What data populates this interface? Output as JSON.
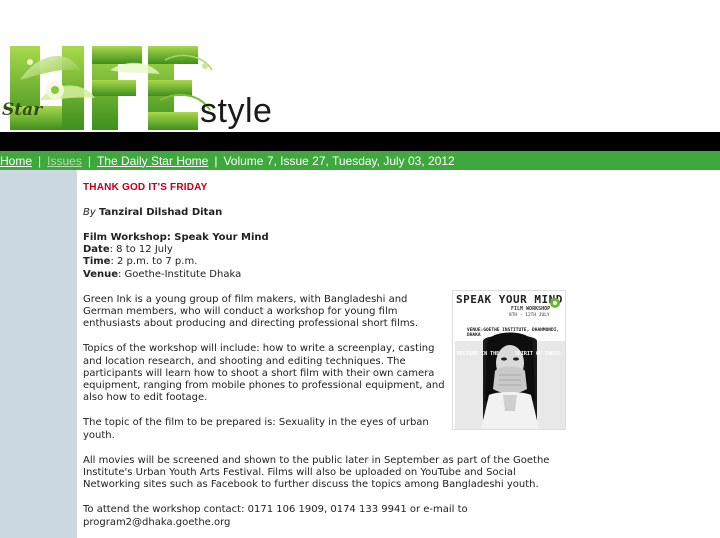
{
  "masthead": {
    "brand_small": "Star",
    "brand_style": "style"
  },
  "nav": {
    "home": "Home",
    "issues": "Issues",
    "daily_star_home": "The Daily Star Home",
    "issue_info": "Volume 7, Issue 27, Tuesday, July 03, 2012",
    "separator": "|"
  },
  "article": {
    "kicker": "THANK GOD IT'S FRIDAY",
    "byline_prefix": "By",
    "author": "Tanziral Dilshad Ditan",
    "event_title": "Film Workshop: Speak Your Mind",
    "date_label": "Date",
    "date_value": ": 8 to 12 July",
    "time_label": "Time",
    "time_value": ": 2 p.m. to 7 p.m.",
    "venue_label": "Venue",
    "venue_value": ": Goethe-Institute Dhaka",
    "paragraphs": [
      "Green Ink is a young group of film makers, with Bangladeshi and German members, who will conduct a workshop for young film enthusiasts about producing and directing professional short films.",
      "Topics of the workshop will include: how to write a screenplay, casting and location research, and shooting and editing techniques. The participants will learn how to shoot a short film with their own camera equipment, ranging from mobile phones to professional equipment, and also how to edit footage.",
      "The topic of the film to be prepared is: Sexuality in the eyes of urban youth.",
      "All movies will be screened and shown to the public later in September as part of the Goethe Institute's Urban Youth Arts Festival. Films will also be uploaded on YouTube and Social Networking sites such as Facebook to further discuss the topics among Bangladeshi youth.",
      "To attend the workshop contact: 0171 106 1909, 0174 133 9941 or e-mail to program2@dhaka.goethe.org"
    ]
  },
  "poster": {
    "title": "SPEAK YOUR MIND",
    "subtitle": "FILM WORKSHOP",
    "dates": "8TH - 12TH JULY",
    "venue": "VENUE:GOETHE INSTITUTE, DHANMONDI, DHAKA",
    "tagline_left": "BELIEVE IN THE",
    "tagline_right": "SPIRIT OF INDIE."
  },
  "colors": {
    "nav_green": "#3ea83e",
    "sidebar_blue": "#ccd8e1",
    "kicker_red": "#c0001a"
  }
}
